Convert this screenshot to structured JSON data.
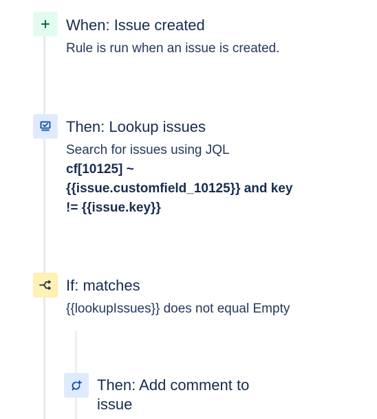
{
  "steps": {
    "trigger": {
      "title": "When: Issue created",
      "description": "Rule is run when an issue is created.",
      "icon": "plus-icon",
      "color": "#006644"
    },
    "lookup": {
      "title": "Then: Lookup issues",
      "description": "Search for issues using JQL",
      "jql_lines": [
        "cf[10125] ~",
        "{{issue.customfield_10125}} and key",
        "!= {{issue.key}}"
      ],
      "icon": "monitor-check-icon",
      "color": "#0747a6"
    },
    "condition": {
      "title": "If: matches",
      "description": "{{lookupIssues}} does not equal Empty",
      "icon": "branch-icon",
      "color": "#ffc400"
    },
    "comment": {
      "title_lines": [
        "Then: Add comment to",
        "issue"
      ],
      "icon": "comment-add-icon",
      "color": "#0747a6"
    }
  }
}
